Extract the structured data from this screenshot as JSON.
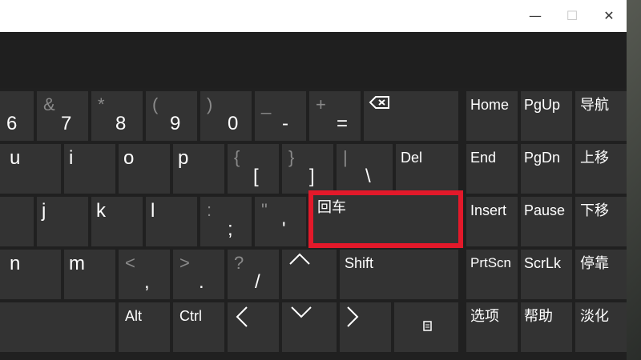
{
  "window": {
    "minimize": "—",
    "maximize": "☐",
    "close": "✕"
  },
  "keys": {
    "r1": {
      "k6": {
        "primary": "6",
        "secondary": ""
      },
      "k7": {
        "primary": "7",
        "secondary": "&"
      },
      "k8": {
        "primary": "8",
        "secondary": "*"
      },
      "k9": {
        "primary": "9",
        "secondary": "("
      },
      "k0": {
        "primary": "0",
        "secondary": ")"
      },
      "minus": {
        "primary": "-",
        "secondary": "_"
      },
      "equals": {
        "primary": "=",
        "secondary": "+"
      },
      "backspace": {
        "icon": "backspace-icon"
      }
    },
    "r2": {
      "u": "u",
      "i": "i",
      "o": "o",
      "p": "p",
      "lbracket": {
        "primary": "[",
        "secondary": "{"
      },
      "rbracket": {
        "primary": "]",
        "secondary": "}"
      },
      "backslash": {
        "primary": "\\",
        "secondary": "|"
      },
      "del": "Del"
    },
    "r3": {
      "j": "j",
      "k": "k",
      "l": "l",
      "semicolon": {
        "primary": ";",
        "secondary": ":"
      },
      "quote": {
        "primary": "'",
        "secondary": "\""
      },
      "enter": "回车"
    },
    "r4": {
      "n": "n",
      "m": "m",
      "comma": {
        "primary": ",",
        "secondary": "<"
      },
      "period": {
        "primary": ".",
        "secondary": ">"
      },
      "slash": {
        "primary": "/",
        "secondary": "?"
      },
      "up": {
        "icon": "arrow-up-icon"
      },
      "shift": "Shift"
    },
    "r5": {
      "alt": "Alt",
      "ctrl": "Ctrl",
      "left": {
        "icon": "arrow-left-icon"
      },
      "down": {
        "icon": "arrow-down-icon"
      },
      "right": {
        "icon": "arrow-right-icon"
      },
      "menu": {
        "icon": "context-menu-icon"
      }
    },
    "nav": {
      "home": "Home",
      "pgup": "PgUp",
      "dock": "导航",
      "end": "End",
      "pgdn": "PgDn",
      "moveup": "上移",
      "insert": "Insert",
      "pause": "Pause",
      "movedown": "下移",
      "prtscn": "PrtScn",
      "scrlk": "ScrLk",
      "dock_pause": "停靠",
      "options": "选项",
      "help": "帮助",
      "fade": "淡化"
    }
  },
  "highlight": {
    "color": "#e3192a",
    "target": "enter-key"
  },
  "colors": {
    "key_bg": "#333333",
    "keyboard_bg": "#202020",
    "title_bg": "#ffffff",
    "secondary_text": "#8a8a8a"
  }
}
